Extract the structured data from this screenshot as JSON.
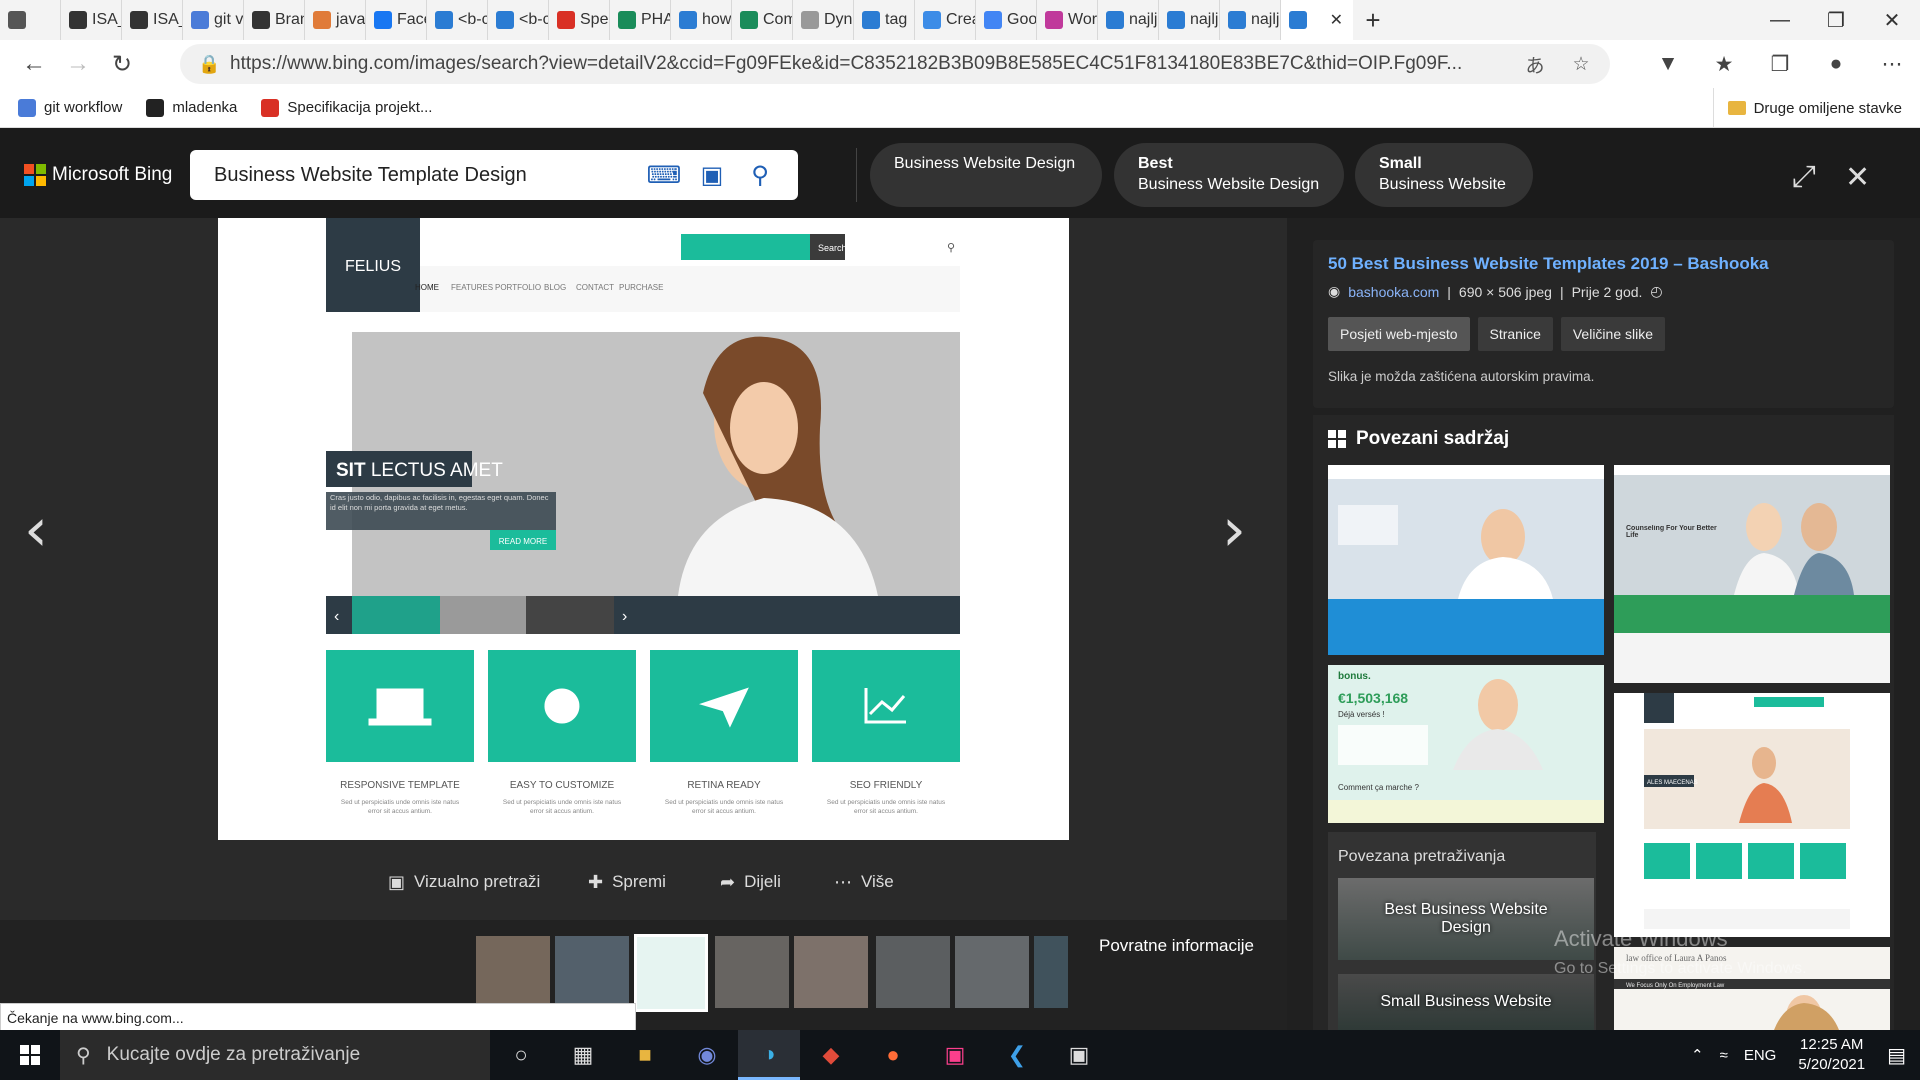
{
  "browser": {
    "tabs": [
      {
        "label": "",
        "icon": "tab-actions-icon",
        "color": "#555555"
      },
      {
        "label": "ISA_",
        "icon": "github-icon",
        "color": "#333333"
      },
      {
        "label": "ISA_",
        "icon": "github-icon",
        "color": "#333333"
      },
      {
        "label": "git v",
        "icon": "docs-icon",
        "color": "#4a7bd8"
      },
      {
        "label": "Bran",
        "icon": "github-icon",
        "color": "#333333"
      },
      {
        "label": "java",
        "icon": "java-icon",
        "color": "#e07b39"
      },
      {
        "label": "Face",
        "icon": "facebook-icon",
        "color": "#1877f2"
      },
      {
        "label": "<b-c",
        "icon": "bing-icon",
        "color": "#2b7cd3"
      },
      {
        "label": "<b-c",
        "icon": "bing-icon",
        "color": "#2b7cd3"
      },
      {
        "label": "Spec",
        "icon": "pdf-icon",
        "color": "#d93025"
      },
      {
        "label": "PHA",
        "icon": "vue-icon",
        "color": "#1a8c5a"
      },
      {
        "label": "how",
        "icon": "bing-icon",
        "color": "#2b7cd3"
      },
      {
        "label": "Com",
        "icon": "vue-icon",
        "color": "#1a8c5a"
      },
      {
        "label": "Dyn",
        "icon": "play-icon",
        "color": "#999999"
      },
      {
        "label": "tag",
        "icon": "bing-icon",
        "color": "#2b7cd3"
      },
      {
        "label": "Crea",
        "icon": "edge-icon",
        "color": "#3c8ce7"
      },
      {
        "label": "Goo",
        "icon": "translate-icon",
        "color": "#4285f4"
      },
      {
        "label": "Wor",
        "icon": "list-icon",
        "color": "#c0399b"
      },
      {
        "label": "najlj",
        "icon": "bing-icon",
        "color": "#2b7cd3"
      },
      {
        "label": "najlj",
        "icon": "bing-icon",
        "color": "#2b7cd3"
      },
      {
        "label": "najlj",
        "icon": "bing-icon",
        "color": "#2b7cd3"
      }
    ],
    "active_tab_close": "✕",
    "new_tab": "+",
    "url": "https://www.bing.com/images/search?view=detailV2&ccid=Fg09FEke&id=C8352182B3B09B8E585EC4C51F8134180E83BE7C&thid=OIP.Fg09F...",
    "bookmarks": [
      {
        "label": "git workflow",
        "icon": "docs-icon",
        "color": "#4a7bd8"
      },
      {
        "label": "mladenka",
        "icon": "github-icon",
        "color": "#222222"
      },
      {
        "label": "Specifikacija projekt...",
        "icon": "pdf-icon",
        "color": "#d93025"
      }
    ],
    "other_bookmarks": "Druge omiljene stavke"
  },
  "bing": {
    "logo_text": "Microsoft Bing",
    "search_value": "Business Website Template Design",
    "suggestions": [
      {
        "bold": "",
        "text": "Business Website Design"
      },
      {
        "bold": "Best",
        "text": "Business Website Design"
      },
      {
        "bold": "Small",
        "text": "Business Website"
      }
    ]
  },
  "viewer": {
    "template": {
      "logo": "FELIUS",
      "search": "Search",
      "nav": [
        "HOME",
        "FEATURES",
        "PORTFOLIO",
        "BLOG",
        "CONTACT",
        "PURCHASE"
      ],
      "hero_title_bold": "SIT",
      "hero_title": "LECTUS AMET",
      "hero_text": "Cras justo odio, dapibus ac facilisis in, egestas eget quam. Donec id elit non mi porta gravida at eget metus.",
      "hero_button": "READ MORE",
      "features": [
        {
          "title": "RESPONSIVE TEMPLATE",
          "icon": "laptop-icon"
        },
        {
          "title": "EASY TO CUSTOMIZE",
          "icon": "gear-icon"
        },
        {
          "title": "RETINA READY",
          "icon": "paper-plane-icon"
        },
        {
          "title": "SEO FRIENDLY",
          "icon": "chart-icon"
        }
      ],
      "feature_text": "Sed ut perspiciatis unde omnis iste natus error sit accus antium.",
      "accent": "#1bbc9b"
    },
    "actions": [
      {
        "label": "Vizualno pretraži",
        "icon": "visual-search-icon"
      },
      {
        "label": "Spremi",
        "icon": "save-icon"
      },
      {
        "label": "Dijeli",
        "icon": "share-icon"
      },
      {
        "label": "Više",
        "icon": "more-icon"
      }
    ],
    "feedback": "Povratne informacije",
    "status": "Čekanje na www.bing.com..."
  },
  "panel": {
    "title": "50 Best Business Website Templates 2019 – Bashooka",
    "source": "bashooka.com",
    "dimensions": "690 × 506 jpeg",
    "age": "Prije 2 god.",
    "buttons": [
      "Posjeti web-mjesto",
      "Stranice",
      "Veličine slike"
    ],
    "copyright": "Slika je možda zaštićena autorskim pravima.",
    "related_heading": "Povezani sadržaj",
    "related_search_heading": "Povezana pretraživanja",
    "related_searches": [
      "Best Business Website Design",
      "Small Business Website"
    ],
    "thumb_texts": {
      "counseling": "Counseling For Your Better Life",
      "bonus_brand": "bonus.",
      "bonus_counter": "€1,503,168",
      "bonus_sub": "Déjà versés !",
      "bonus_q": "Comment ça marche ?",
      "law": "law office of Laura A Panos",
      "law_sub": "We Focus Only On Employment Law",
      "ales": "ALES MAECENAS"
    }
  },
  "watermark": {
    "line1": "Activate Windows",
    "line2": "Go to Settings to activate Windows."
  },
  "taskbar": {
    "search_placeholder": "Kucajte ovdje za pretraživanje",
    "lang": "ENG",
    "time": "12:25 AM",
    "date": "5/20/2021"
  }
}
